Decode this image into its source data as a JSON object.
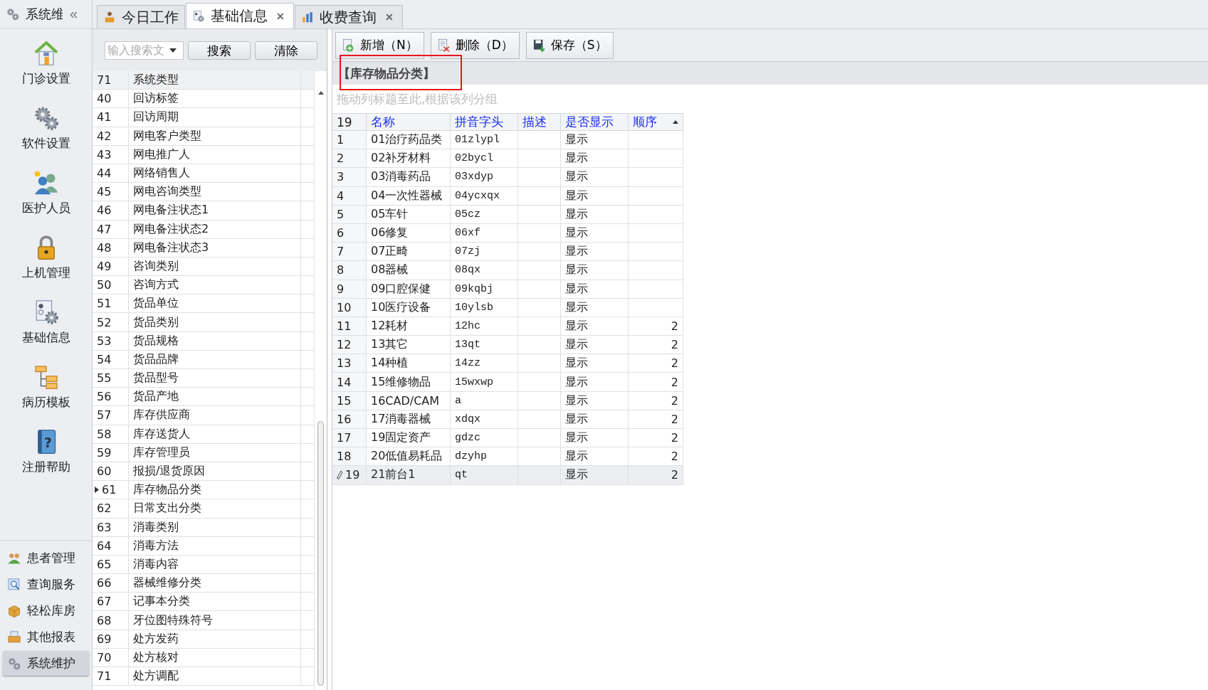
{
  "nav": {
    "title": "系统维",
    "collapse": "«",
    "help_glyph": "?",
    "items": [
      {
        "label": "门诊设置"
      },
      {
        "label": "软件设置"
      },
      {
        "label": "医护人员"
      },
      {
        "label": "上机管理"
      },
      {
        "label": "基础信息"
      },
      {
        "label": "病历模板"
      },
      {
        "label": "注册帮助"
      }
    ],
    "groups": [
      {
        "label": "患者管理",
        "selected": false
      },
      {
        "label": "查询服务",
        "selected": false
      },
      {
        "label": "轻松库房",
        "selected": false
      },
      {
        "label": "其他报表",
        "selected": false
      },
      {
        "label": "系统维护",
        "selected": true
      }
    ]
  },
  "tabs": [
    {
      "label": "今日工作",
      "selected": false,
      "closable": false
    },
    {
      "label": "基础信息",
      "selected": true,
      "closable": true
    },
    {
      "label": "收费查询",
      "selected": false,
      "closable": true
    }
  ],
  "close_glyph": "✕",
  "list": {
    "search": {
      "placeholder": "输入搜索文"
    },
    "buttons": [
      "搜索",
      "清除"
    ],
    "top_row": {
      "id": "71",
      "name": "系统类型"
    },
    "rows": [
      {
        "id": "40",
        "name": "回访标签",
        "selected": false
      },
      {
        "id": "41",
        "name": "回访周期",
        "selected": false
      },
      {
        "id": "42",
        "name": "网电客户类型",
        "selected": false
      },
      {
        "id": "43",
        "name": "网电推广人",
        "selected": false
      },
      {
        "id": "44",
        "name": "网络销售人",
        "selected": false
      },
      {
        "id": "45",
        "name": "网电咨询类型",
        "selected": false
      },
      {
        "id": "46",
        "name": "网电备注状态1",
        "selected": false
      },
      {
        "id": "47",
        "name": "网电备注状态2",
        "selected": false
      },
      {
        "id": "48",
        "name": "网电备注状态3",
        "selected": false
      },
      {
        "id": "49",
        "name": "咨询类别",
        "selected": false
      },
      {
        "id": "50",
        "name": "咨询方式",
        "selected": false
      },
      {
        "id": "51",
        "name": "货品单位",
        "selected": false
      },
      {
        "id": "52",
        "name": "货品类别",
        "selected": false
      },
      {
        "id": "53",
        "name": "货品规格",
        "selected": false
      },
      {
        "id": "54",
        "name": "货品品牌",
        "selected": false
      },
      {
        "id": "55",
        "name": "货品型号",
        "selected": false
      },
      {
        "id": "56",
        "name": "货品产地",
        "selected": false
      },
      {
        "id": "57",
        "name": "库存供应商",
        "selected": false
      },
      {
        "id": "58",
        "name": "库存送货人",
        "selected": false
      },
      {
        "id": "59",
        "name": "库存管理员",
        "selected": false
      },
      {
        "id": "60",
        "name": "报损/退货原因",
        "selected": false
      },
      {
        "id": "61",
        "name": "库存物品分类",
        "selected": true
      },
      {
        "id": "62",
        "name": "日常支出分类",
        "selected": false
      },
      {
        "id": "63",
        "name": "消毒类别",
        "selected": false
      },
      {
        "id": "64",
        "name": "消毒方法",
        "selected": false
      },
      {
        "id": "65",
        "name": "消毒内容",
        "selected": false
      },
      {
        "id": "66",
        "name": "器械维修分类",
        "selected": false
      },
      {
        "id": "67",
        "name": "记事本分类",
        "selected": false
      },
      {
        "id": "68",
        "name": "牙位图特殊符号",
        "selected": false
      },
      {
        "id": "69",
        "name": "处方发药",
        "selected": false
      },
      {
        "id": "70",
        "name": "处方核对",
        "selected": false
      },
      {
        "id": "71",
        "name": "处方调配",
        "selected": false
      }
    ]
  },
  "toolbar": [
    "新增（N）",
    "删除（D）",
    "保存（S）"
  ],
  "section_title": "【库存物品分类】",
  "group_hint": "拖动列标题至此,根据该列分组",
  "grid": {
    "row_count": "19",
    "columns": [
      {
        "label": "名称",
        "sorted": false
      },
      {
        "label": "拼音字头",
        "sorted": false
      },
      {
        "label": "描述",
        "sorted": false
      },
      {
        "label": "是否显示",
        "sorted": false
      },
      {
        "label": "顺序",
        "sorted": true
      }
    ],
    "rows": [
      {
        "n": "1",
        "cells": [
          "01治疗药品类",
          "01zlypl",
          "",
          "显示",
          ""
        ],
        "selected": false
      },
      {
        "n": "2",
        "cells": [
          "02补牙材料",
          "02bycl",
          "",
          "显示",
          ""
        ],
        "selected": false
      },
      {
        "n": "3",
        "cells": [
          "03消毒药品",
          "03xdyp",
          "",
          "显示",
          ""
        ],
        "selected": false
      },
      {
        "n": "4",
        "cells": [
          "04一次性器械",
          "04ycxqx",
          "",
          "显示",
          ""
        ],
        "selected": false
      },
      {
        "n": "5",
        "cells": [
          "05车针",
          "05cz",
          "",
          "显示",
          ""
        ],
        "selected": false
      },
      {
        "n": "6",
        "cells": [
          "06修复",
          "06xf",
          "",
          "显示",
          ""
        ],
        "selected": false
      },
      {
        "n": "7",
        "cells": [
          "07正畸",
          "07zj",
          "",
          "显示",
          ""
        ],
        "selected": false
      },
      {
        "n": "8",
        "cells": [
          "08器械",
          "08qx",
          "",
          "显示",
          ""
        ],
        "selected": false
      },
      {
        "n": "9",
        "cells": [
          "09口腔保健",
          "09kqbj",
          "",
          "显示",
          ""
        ],
        "selected": false
      },
      {
        "n": "10",
        "cells": [
          "10医疗设备",
          "10ylsb",
          "",
          "显示",
          ""
        ],
        "selected": false
      },
      {
        "n": "11",
        "cells": [
          "12耗材",
          "12hc",
          "",
          "显示",
          "2"
        ],
        "selected": false
      },
      {
        "n": "12",
        "cells": [
          "13其它",
          "13qt",
          "",
          "显示",
          "2"
        ],
        "selected": false
      },
      {
        "n": "13",
        "cells": [
          "14种植",
          "14zz",
          "",
          "显示",
          "2"
        ],
        "selected": false
      },
      {
        "n": "14",
        "cells": [
          "15维修物品",
          "15wxwp",
          "",
          "显示",
          "2"
        ],
        "selected": false
      },
      {
        "n": "15",
        "cells": [
          "16CAD/CAM",
          "a",
          "",
          "显示",
          "2"
        ],
        "selected": false
      },
      {
        "n": "16",
        "cells": [
          "17消毒器械",
          "xdqx",
          "",
          "显示",
          "2"
        ],
        "selected": false
      },
      {
        "n": "17",
        "cells": [
          "19固定资产",
          "gdzc",
          "",
          "显示",
          "2"
        ],
        "selected": false
      },
      {
        "n": "18",
        "cells": [
          "20低值易耗品",
          "dzyhp",
          "",
          "显示",
          "2"
        ],
        "selected": false
      },
      {
        "n": "19",
        "cells": [
          "21前台1",
          "qt",
          "",
          "显示",
          "2"
        ],
        "selected": true
      }
    ]
  }
}
